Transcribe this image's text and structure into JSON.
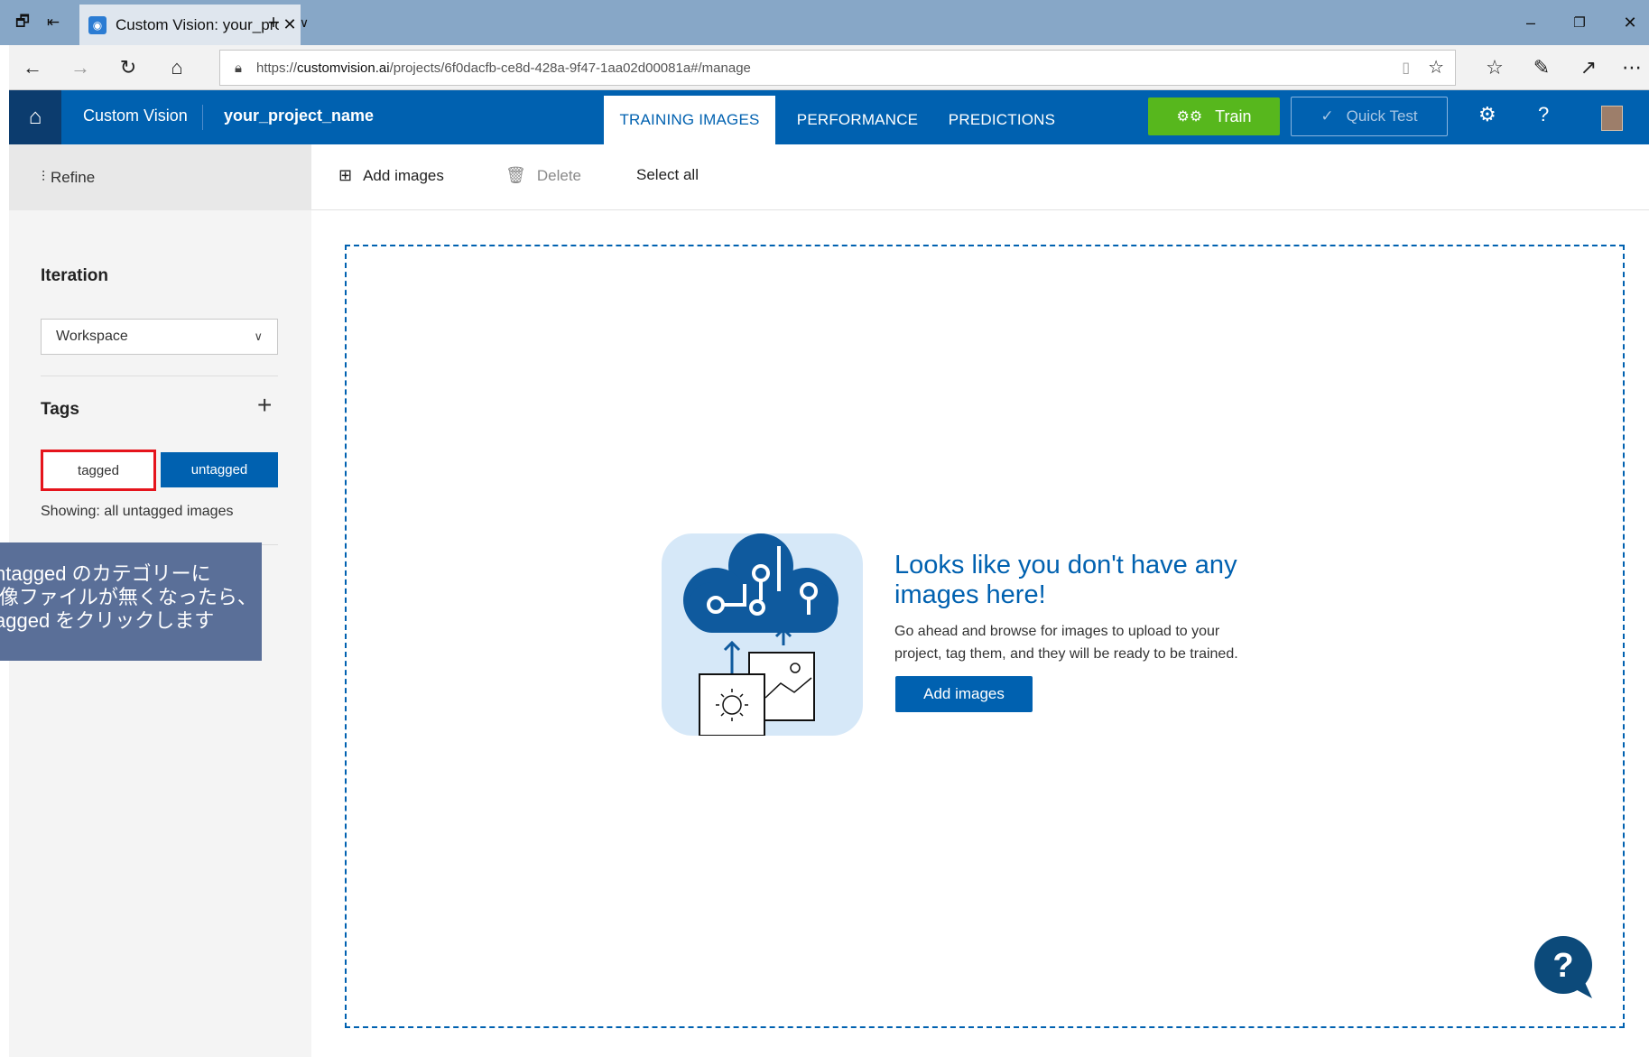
{
  "browser": {
    "tab_title": "Custom Vision: your_pro",
    "url_prefix": "https://",
    "url_domain": "customvision.ai",
    "url_path": "/projects/6f0dacfb-ce8d-428a-9f47-1aa02d00081a#/manage"
  },
  "app": {
    "title": "Custom Vision",
    "project_name": "your_project_name",
    "nav_tabs": [
      "TRAINING IMAGES",
      "PERFORMANCE",
      "PREDICTIONS"
    ],
    "train_label": "Train",
    "quick_test_label": "Quick Test",
    "help_glyph": "?"
  },
  "sidebar": {
    "refine_label": "Refine",
    "iteration_heading": "Iteration",
    "iteration_value": "Workspace",
    "tags_heading": "Tags",
    "tagged_label": "tagged",
    "untagged_label": "untagged",
    "showing_text": "Showing: all untagged images"
  },
  "toolbar": {
    "add_images_label": "Add images",
    "delete_label": "Delete",
    "select_all_label": "Select all"
  },
  "empty_state": {
    "title_line1": "Looks like you don't have any",
    "title_line2": "images here!",
    "desc_line1": "Go ahead and browse for images to upload to your",
    "desc_line2": "project, tag them, and they will be ready to be trained.",
    "add_images_label": "Add images"
  },
  "callout": {
    "line1": "ntagged のカテゴリーに",
    "line2": "i像ファイルが無くなったら、",
    "line3": "agged をクリックします"
  },
  "colors": {
    "brand_blue": "#0061b0",
    "train_green": "#57b71d",
    "highlight_red": "#e5141c",
    "callout_bg": "#5a6f98"
  }
}
